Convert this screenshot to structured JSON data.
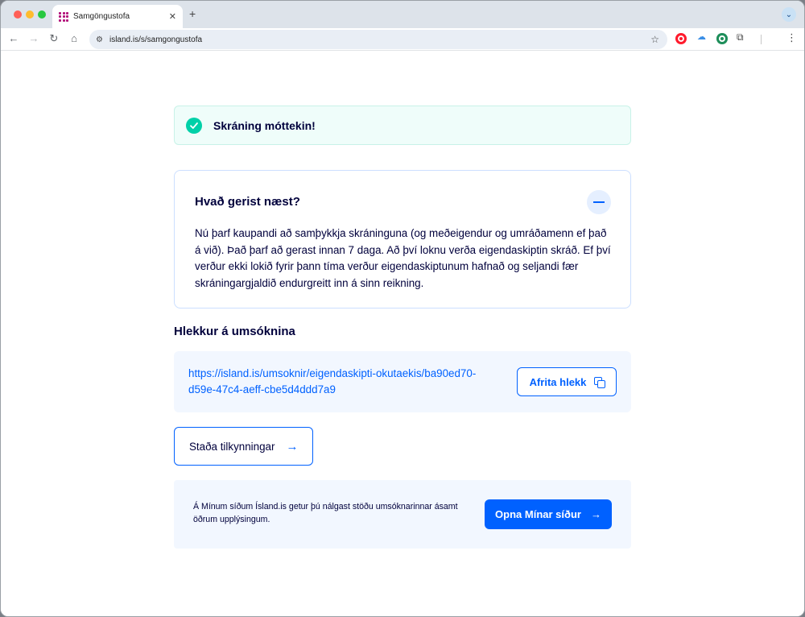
{
  "browser": {
    "tab_title": "Samgöngustofa",
    "tab_close": "✕",
    "new_tab": "+",
    "tab_menu": "⌄",
    "url": "island.is/s/samgongustofa",
    "nav": {
      "back": "←",
      "forward": "→",
      "reload": "↻",
      "home": "⌂"
    },
    "star": "☆",
    "kebab": "⋮"
  },
  "alert": {
    "text": "Skráning móttekin!",
    "color": "#00d0a8"
  },
  "accordion": {
    "title": "Hvað gerist næst?",
    "body": "Nú þarf kaupandi að samþykkja skráninguna (og meðeigendur og umráðamenn ef það á við). Það þarf að gerast innan 7 daga. Að því loknu verða eigendaskiptin skráð. Ef því verður ekki lokið fyrir þann tíma verður eigendaskiptunum hafnað og seljandi fær skráningargjaldið endurgreitt inn á sinn reikning."
  },
  "link_section": {
    "heading": "Hlekkur á umsóknina",
    "url": "https://island.is/umsoknir/eigendaskipti-okutaekis/ba90ed70-d59e-47c4-aeff-cbe5d4ddd7a9",
    "copy_label": "Afrita hlekk"
  },
  "status_button": {
    "label": "Staða tilkynningar",
    "arrow": "→"
  },
  "my_pages": {
    "text": "Á Mínum síðum Ísland.is getur þú nálgast stöðu umsóknarinnar ásamt öðrum upplýsingum.",
    "button_label": "Opna Mínar síður",
    "arrow": "→"
  },
  "colors": {
    "primary": "#0061ff",
    "text": "#00003c",
    "link_box_bg": "#f2f7ff"
  }
}
